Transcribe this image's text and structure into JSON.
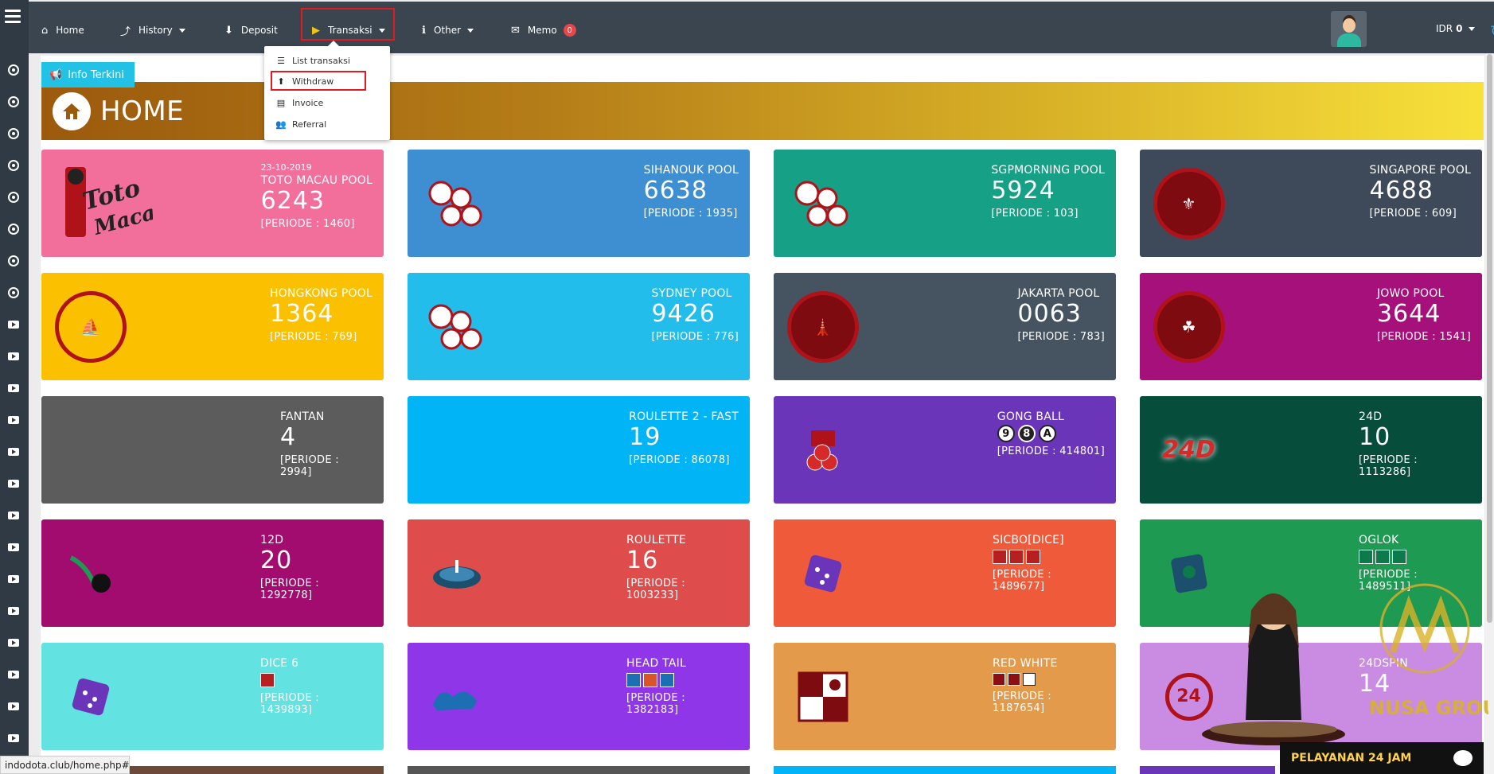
{
  "nav": {
    "home": "Home",
    "history": "History",
    "deposit": "Deposit",
    "transaksi": "Transaksi",
    "other": "Other",
    "memo": "Memo",
    "memo_count": "0",
    "currency_label": "IDR",
    "balance": "0"
  },
  "dropdown": {
    "items": [
      "List transaksi",
      "Withdraw",
      "Invoice",
      "Referral"
    ]
  },
  "info_tag": "Info Terkini",
  "banner_title": "HOME",
  "cards": [
    {
      "date": "23-10-2019",
      "name": "TOTO MACAU POOL",
      "num": "6243",
      "periode": "[PERIODE : 1460]",
      "color": "#f26f9c"
    },
    {
      "name": "SIHANOUK POOL",
      "num": "6638",
      "periode": "[PERIODE : 1935]",
      "color": "#3d8fd1"
    },
    {
      "name": "SGPMORNING POOL",
      "num": "5924",
      "periode": "[PERIODE : 103]",
      "color": "#16a085"
    },
    {
      "name": "SINGAPORE POOL",
      "num": "4688",
      "periode": "[PERIODE : 609]",
      "color": "#3e4a5a"
    },
    {
      "name": "HONGKONG POOL",
      "num": "1364",
      "periode": "[PERIODE : 769]",
      "color": "#fbc100"
    },
    {
      "name": "SYDNEY POOL",
      "num": "9426",
      "periode": "[PERIODE : 776]",
      "color": "#22bdea"
    },
    {
      "name": "JAKARTA POOL",
      "num": "0063",
      "periode": "[PERIODE : 783]",
      "color": "#465462"
    },
    {
      "name": "JOWO POOL",
      "num": "3644",
      "periode": "[PERIODE : 1541]",
      "color": "#a6107a"
    },
    {
      "name": "FANTAN",
      "num": "4",
      "periode": "[PERIODE : 2994]",
      "color": "#5c5c5c"
    },
    {
      "name": "ROULETTE 2 - FAST",
      "num": "19",
      "periode": "[PERIODE : 86078]",
      "color": "#00b4f5"
    },
    {
      "name": "GONG BALL",
      "balls": [
        "9",
        "8",
        "A"
      ],
      "periode": "[PERIODE : 414801]",
      "color": "#6a35b8"
    },
    {
      "name": "24D",
      "num": "10",
      "periode": "[PERIODE : 1113286]",
      "color": "#064d3c"
    },
    {
      "name": "12D",
      "num": "20",
      "periode": "[PERIODE : 1292778]",
      "color": "#a20c6e"
    },
    {
      "name": "ROULETTE",
      "num": "16",
      "periode": "[PERIODE : 1003233]",
      "color": "#de4d4b"
    },
    {
      "name": "SICBO[DICE]",
      "periode": "[PERIODE : 1489677]",
      "color": "#ee5a3a"
    },
    {
      "name": "OGLOK",
      "periode": "[PERIODE : 1489511]",
      "color": "#1f9a53"
    },
    {
      "name": "DICE 6",
      "periode": "[PERIODE : 1439893]",
      "color": "#62e2e0"
    },
    {
      "name": "HEAD TAIL",
      "periode": "[PERIODE : 1382183]",
      "color": "#8e36e8"
    },
    {
      "name": "RED WHITE",
      "periode": "[PERIODE : 1187654]",
      "color": "#e39a4a"
    },
    {
      "name": "24DSPIN",
      "num": "14",
      "color": "#c98ce2"
    }
  ],
  "logo_texts": {
    "toto_macau": "Toto Macau",
    "twentyfour_d": "24D",
    "twentyfour": "24"
  },
  "chatbar": "PELAYANAN 24 JAM",
  "nusa": "NUSA GROUP",
  "statusbar": "indodota.club/home.php#",
  "colors": {
    "topbar": "#3b4550",
    "rail": "#2f3a45",
    "highlight": "#e21b23",
    "info": "#22c1e6"
  }
}
